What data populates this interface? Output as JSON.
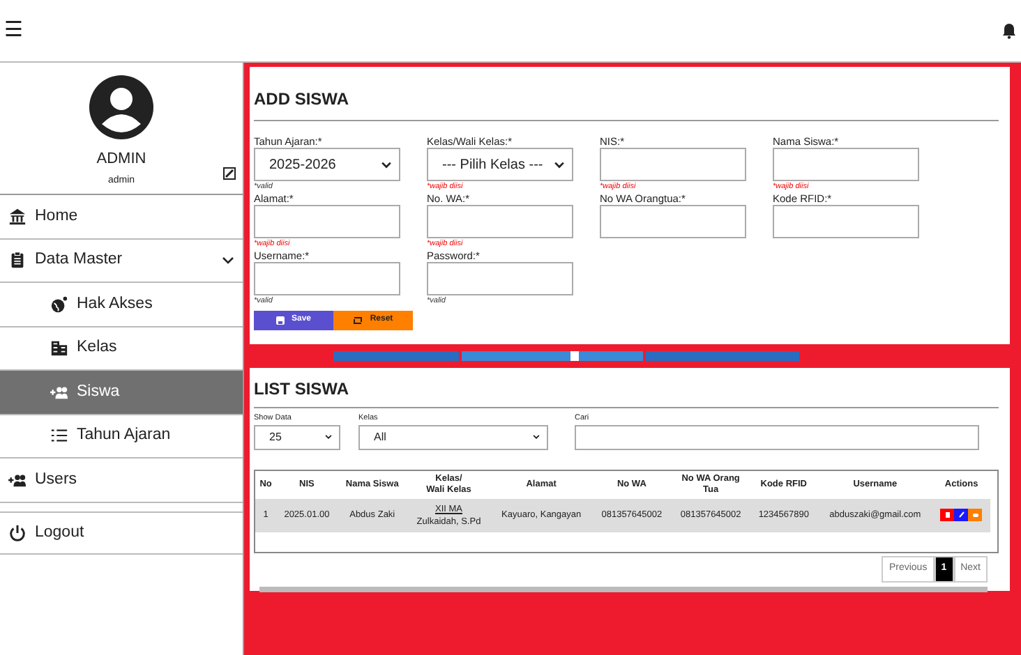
{
  "topbar": {
    "menu_icon": "☰"
  },
  "profile": {
    "name": "ADMIN",
    "role": "admin"
  },
  "sidebar": {
    "items": [
      {
        "label": "Home",
        "kind": "bank",
        "selected": false
      },
      {
        "label": "Data Master",
        "kind": "clipboard",
        "selected": false,
        "expanded": true,
        "children": [
          {
            "label": "Hak Akses",
            "kind": "globe",
            "selected": false
          },
          {
            "label": "Kelas",
            "kind": "building",
            "selected": false
          },
          {
            "label": "Siswa",
            "kind": "users",
            "selected": true
          },
          {
            "label": "Tahun Ajaran",
            "kind": "list",
            "selected": false
          }
        ]
      },
      {
        "label": "Users",
        "kind": "users",
        "selected": false
      },
      {
        "label": "Logout",
        "kind": "power",
        "selected": false
      }
    ]
  },
  "add_form": {
    "title": "ADD SISWA",
    "fields": [
      {
        "label": "Tahun Ajaran:*",
        "kind": "select",
        "value": "2025-2026",
        "note": "*valid",
        "valid": true
      },
      {
        "label": "Kelas/Wali Kelas:*",
        "kind": "select",
        "value": "--- Pilih Kelas ---",
        "note": "*wajib diisi",
        "valid": false
      },
      {
        "label": "NIS:*",
        "kind": "input",
        "note": "*wajib diisi",
        "valid": false
      },
      {
        "label": "Nama Siswa:*",
        "kind": "input",
        "note": "*wajib diisi",
        "valid": false
      },
      {
        "label": "Alamat:*",
        "kind": "input",
        "note": "*wajib diisi",
        "valid": false
      },
      {
        "label": "No. WA:*",
        "kind": "input",
        "note": "*wajib diisi",
        "valid": false
      },
      {
        "label": "No WA Orangtua:*",
        "kind": "input"
      },
      {
        "label": "Kode RFID:*",
        "kind": "input"
      },
      {
        "label": "Username:*",
        "kind": "input",
        "note": "*valid",
        "valid": true
      },
      {
        "label": "Password:*",
        "kind": "input",
        "note": "*valid",
        "valid": true
      }
    ],
    "buttons": [
      {
        "label": "Save",
        "kind": "save"
      },
      {
        "label": "Reset",
        "kind": "reset"
      }
    ]
  },
  "list": {
    "title": "LIST SISWA",
    "filters": [
      {
        "label": "Show Data",
        "kind": "select",
        "value": "25"
      },
      {
        "label": "Kelas",
        "kind": "select",
        "value": "All"
      },
      {
        "label": "Cari",
        "kind": "input"
      }
    ],
    "table": {
      "columns": [
        "No",
        "NIS",
        "Nama Siswa",
        "Kelas/\nWali Kelas",
        "Alamat",
        "No WA",
        "No WA Orang\nTua",
        "Kode RFID",
        "Username",
        "Actions"
      ],
      "rows": [
        {
          "no": "1",
          "nis": "2025.01.00",
          "nama": "Abdus Zaki",
          "kelas": "XII MA",
          "wali": "Zulkaidah, S.Pd",
          "alamat": "Kayuaro, Kangayan",
          "wa": "081357645002",
          "wa_ortu": "081357645002",
          "rfid": "1234567890",
          "username": "abduszaki@gmail.com",
          "actions": [
            {
              "kind": "delete",
              "color": "#ff0000"
            },
            {
              "kind": "edit",
              "color": "#1a1aff"
            },
            {
              "kind": "print",
              "color": "#ff7f00"
            }
          ]
        }
      ]
    },
    "pagination": [
      {
        "label": "Previous",
        "selected": false
      },
      {
        "label": "1",
        "selected": true
      },
      {
        "label": "Next",
        "selected": false
      }
    ]
  }
}
